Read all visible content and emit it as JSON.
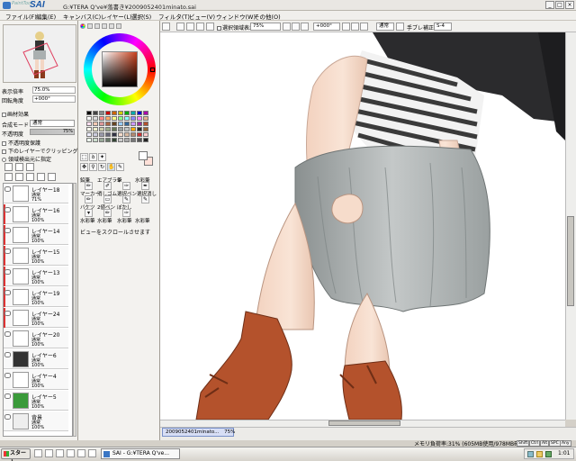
{
  "titlebar": {
    "app_logo_small": "PaintTool",
    "app_logo": "SAI",
    "title": "G:¥TERA Q've¥落書き¥2009052401minato.sai",
    "buttons": {
      "minimize": "_",
      "maximize": "□",
      "close": "×"
    }
  },
  "menu": [
    "ファイル(F)",
    "編集(E)",
    "キャンバス(C)",
    "レイヤー(L)",
    "選択(S)",
    "フィルタ(T)",
    "ビュー(V)",
    "ウィンドウ(W)",
    "その他(O)"
  ],
  "navigator": {
    "zoom_label": "表示倍率",
    "zoom_value": "75.0%",
    "rotate_label": "回転角度",
    "rotate_value": "+000°"
  },
  "layer_props": {
    "texture_label": "画材効果",
    "blend_label": "合成モード",
    "blend_value": "通常",
    "opacity_label": "不透明度",
    "opacity_value": "75%",
    "checks": [
      "不透明度保護",
      "下のレイヤーでクリッピング",
      "領域検出元に指定"
    ]
  },
  "layers": [
    {
      "name": "レイヤー18",
      "mode": "通常",
      "opacity": "71%"
    },
    {
      "name": "レイヤー16",
      "mode": "通常",
      "opacity": "100%"
    },
    {
      "name": "レイヤー14",
      "mode": "通常",
      "opacity": "100%"
    },
    {
      "name": "レイヤー15",
      "mode": "通常",
      "opacity": "100%"
    },
    {
      "name": "レイヤー13",
      "mode": "通常",
      "opacity": "100%"
    },
    {
      "name": "レイヤー19",
      "mode": "通常",
      "opacity": "100%"
    },
    {
      "name": "レイヤー24",
      "mode": "通常",
      "opacity": "100%"
    },
    {
      "name": "レイヤー20",
      "mode": "通常",
      "opacity": "100%"
    },
    {
      "name": "レイヤー6",
      "mode": "通常",
      "opacity": "100%"
    },
    {
      "name": "レイヤー4",
      "mode": "通常",
      "opacity": "100%"
    },
    {
      "name": "レイヤー5",
      "mode": "通常",
      "opacity": "100%"
    },
    {
      "name": "背景",
      "mode": "通常",
      "opacity": "100%"
    }
  ],
  "tools": {
    "row1": [
      "鉛筆",
      "エアブラシ",
      "筆",
      "水彩筆"
    ],
    "row2": [
      "マーカー",
      "消しゴム",
      "選択ペン",
      "選択消し"
    ],
    "row3": [
      "バケツ",
      "2値ペン",
      "ぼかし",
      ""
    ],
    "row4": [
      "水彩筆",
      "水彩筆",
      "水彩筆",
      "水彩筆"
    ],
    "hint": "ビューをスクロールさせます"
  },
  "canvas_toolbar": {
    "stabilizer_check": "選択領域表示",
    "zoom": "75%",
    "rotation": "+000°",
    "mode": "通常",
    "stabilize_label": "手ブレ補正",
    "stabilize_value": "S-4"
  },
  "status": {
    "doc_tab_name": "2009052401minato...",
    "doc_tab_zoom": "75%",
    "memory": "メモリ負荷率:31% (605MB使用/978MB確保)",
    "indicators": [
      "Shift",
      "Ctrl",
      "Alt",
      "SPC",
      "Any"
    ]
  },
  "taskbar": {
    "start": "スタート",
    "task": "SAI - G:¥TERA Q've...",
    "clock": "1:01"
  },
  "colors": {
    "accent": "#3a76c4",
    "boot": "#b4522c",
    "skin": "#f6dccb",
    "skirt": "#9aa0a0",
    "jacket": "#2b2b2d"
  }
}
